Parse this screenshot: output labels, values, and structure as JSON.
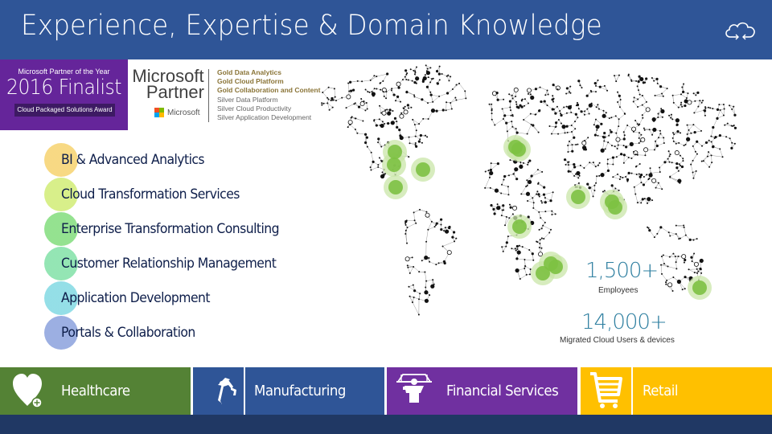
{
  "header": {
    "title": "Experience, Expertise & Domain Knowledge",
    "icon": "cloud-sync-icon",
    "background": "#2f5597"
  },
  "award": {
    "line1": "Microsoft Partner of the Year",
    "line2": "2016 Finalist",
    "line3": "Cloud Packaged Solutions Award",
    "background": "#65259a"
  },
  "partner": {
    "line1": "Microsoft",
    "line2": "Partner",
    "logo_text": "Microsoft",
    "competencies": [
      {
        "label": "Gold Data Analytics",
        "tier": "gold"
      },
      {
        "label": "Gold Cloud Platform",
        "tier": "gold"
      },
      {
        "label": "Gold Collaboration and Content",
        "tier": "gold"
      },
      {
        "label": "Silver Data Platform",
        "tier": "silver"
      },
      {
        "label": "Silver Cloud Productivity",
        "tier": "silver"
      },
      {
        "label": "Silver Application Development",
        "tier": "silver"
      }
    ]
  },
  "services": [
    {
      "label": "BI & Advanced Analytics",
      "color": "#f7d77e"
    },
    {
      "label": "Cloud Transformation Services",
      "color": "#d6ee84"
    },
    {
      "label": "Enterprise Transformation Consulting",
      "color": "#8fe08a"
    },
    {
      "label": "Customer Relationship Management",
      "color": "#8ee4b0"
    },
    {
      "label": "Application Development",
      "color": "#8fdde6"
    },
    {
      "label": "Portals & Collaboration",
      "color": "#97abe0"
    }
  ],
  "stats": [
    {
      "value": "1,500+",
      "label": "Employees"
    },
    {
      "value": "14,000+",
      "label": "Migrated Cloud Users & devices"
    }
  ],
  "map": {
    "label": "world-network-map",
    "highlight_color": "#7dc142"
  },
  "industries": [
    {
      "label": "Healthcare",
      "icon": "heart-plus-icon",
      "color": "#548235"
    },
    {
      "label": "Manufacturing",
      "icon": "robot-arm-icon",
      "color": "#2f5597"
    },
    {
      "label": "Financial Services",
      "icon": "bank-teller-icon",
      "color": "#7030a0"
    },
    {
      "label": "Retail",
      "icon": "shopping-cart-icon",
      "color": "#ffc000"
    }
  ],
  "footer": {
    "background": "#203864"
  }
}
